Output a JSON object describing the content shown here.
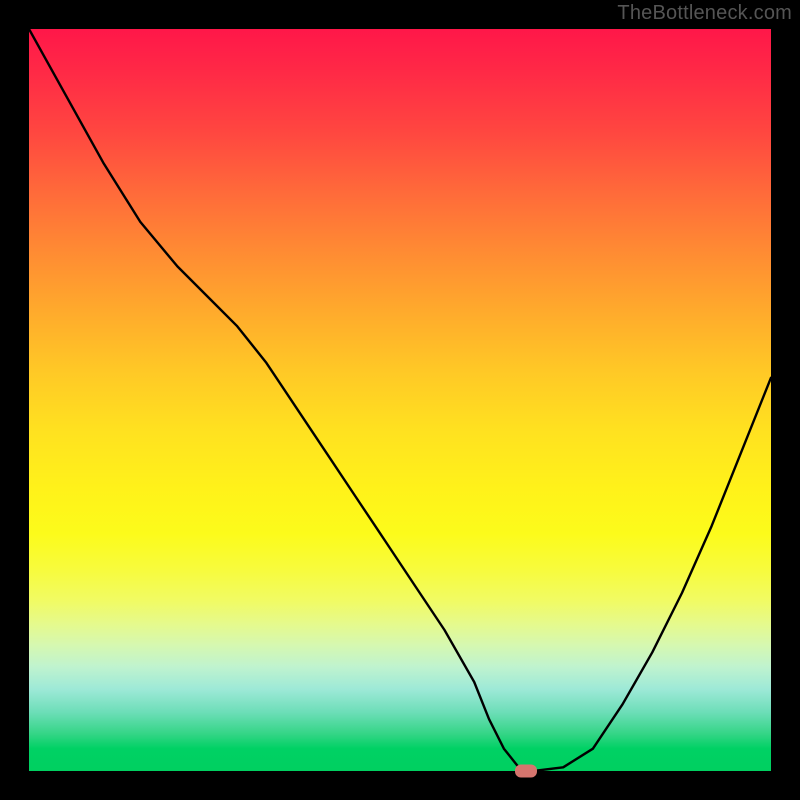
{
  "watermark": "TheBottleneck.com",
  "chart_data": {
    "type": "line",
    "title": "",
    "xlabel": "",
    "ylabel": "",
    "xlim": [
      0,
      100
    ],
    "ylim": [
      0,
      100
    ],
    "x": [
      0,
      5,
      10,
      15,
      20,
      25,
      28,
      32,
      36,
      40,
      44,
      48,
      52,
      56,
      60,
      62,
      64,
      66,
      68,
      72,
      76,
      80,
      84,
      88,
      92,
      96,
      100
    ],
    "values": [
      100,
      91,
      82,
      74,
      68,
      63,
      60,
      55,
      49,
      43,
      37,
      31,
      25,
      19,
      12,
      7,
      3,
      0.5,
      0,
      0.5,
      3,
      9,
      16,
      24,
      33,
      43,
      53
    ],
    "marker": {
      "x": 67,
      "y": 0
    },
    "gradient_description": "vertical red-to-green through orange/yellow",
    "background": "black frame"
  }
}
